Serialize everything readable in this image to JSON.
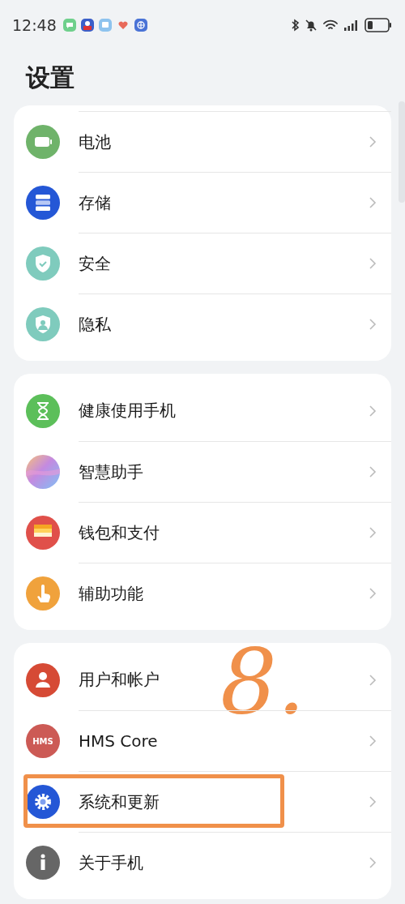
{
  "status_bar": {
    "time": "12:48"
  },
  "title": "设置",
  "groups": [
    {
      "items": [
        {
          "label": "电池"
        },
        {
          "label": "存储"
        },
        {
          "label": "安全"
        },
        {
          "label": "隐私"
        }
      ]
    },
    {
      "items": [
        {
          "label": "健康使用手机"
        },
        {
          "label": "智慧助手"
        },
        {
          "label": "钱包和支付"
        },
        {
          "label": "辅助功能"
        }
      ]
    },
    {
      "items": [
        {
          "label": "用户和帐户",
          "highlighted": false
        },
        {
          "label": "HMS Core",
          "icon_text": "HMS",
          "highlighted": false
        },
        {
          "label": "系统和更新",
          "highlighted": true
        },
        {
          "label": "关于手机",
          "highlighted": false
        }
      ]
    }
  ],
  "annotation": {
    "label": "8."
  }
}
